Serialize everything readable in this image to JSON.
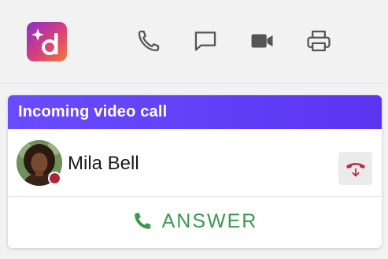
{
  "app": {
    "logo_letter": "d",
    "icons": [
      "phone-icon",
      "chat-icon",
      "video-icon",
      "printer-icon"
    ]
  },
  "call": {
    "header": "Incoming video call",
    "caller_name": "Mila Bell",
    "presence_status_color": "#b0213a",
    "answer_label": "ANSWER",
    "decline_icon": "hang-up-icon"
  },
  "colors": {
    "header_gradient_start": "#6a4cff",
    "header_gradient_end": "#5a35f0",
    "answer_green": "#3a9a4e",
    "decline_red": "#c0263e"
  }
}
